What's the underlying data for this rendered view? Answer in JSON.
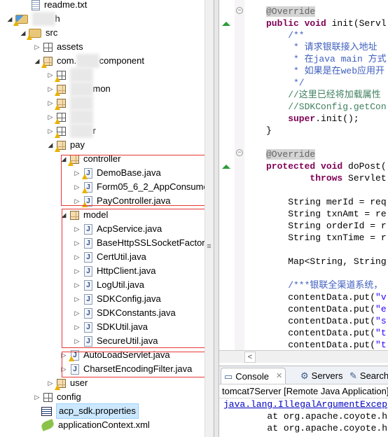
{
  "explorer": {
    "items": [
      {
        "label": "readme.txt",
        "icon": "text-file-icon"
      },
      {
        "label": "",
        "label_tail": "h",
        "icon": "web-project-icon",
        "blurred": true
      },
      {
        "label": "src",
        "icon": "source-folder-icon"
      },
      {
        "label": "assets",
        "icon": "package-icon"
      },
      {
        "label": "com.",
        "label_tail": "component",
        "icon": "package-icon",
        "blurred": true
      },
      {
        "label": "",
        "icon": "package-icon",
        "blurred": true
      },
      {
        "label": "",
        "label_tail": "mon",
        "icon": "package-icon",
        "blurred": true
      },
      {
        "label": "",
        "icon": "package-icon",
        "blurred": true
      },
      {
        "label": "",
        "icon": "package-icon",
        "blurred": true
      },
      {
        "label": "",
        "label_tail": "r",
        "icon": "package-icon",
        "blurred": true
      },
      {
        "label": "pay",
        "icon": "package-icon"
      },
      {
        "label": "controller",
        "icon": "package-icon"
      },
      {
        "label": "DemoBase.java",
        "icon": "java-file-icon"
      },
      {
        "label": "Form05_6_2_AppConsume.",
        "icon": "java-file-icon"
      },
      {
        "label": "PayController.java",
        "icon": "java-file-icon"
      },
      {
        "label": "model",
        "icon": "package-icon"
      },
      {
        "label": "AcpService.java",
        "icon": "java-file-icon"
      },
      {
        "label": "BaseHttpSSLSocketFactory",
        "icon": "java-file-icon"
      },
      {
        "label": "CertUtil.java",
        "icon": "java-file-icon"
      },
      {
        "label": "HttpClient.java",
        "icon": "java-file-icon"
      },
      {
        "label": "LogUtil.java",
        "icon": "java-file-icon"
      },
      {
        "label": "SDKConfig.java",
        "icon": "java-file-icon"
      },
      {
        "label": "SDKConstants.java",
        "icon": "java-file-icon"
      },
      {
        "label": "SDKUtil.java",
        "icon": "java-file-icon"
      },
      {
        "label": "SecureUtil.java",
        "icon": "java-file-icon"
      },
      {
        "label": "AutoLoadServlet.java",
        "icon": "java-file-icon"
      },
      {
        "label": "CharsetEncodingFilter.java",
        "icon": "java-file-icon"
      },
      {
        "label": "user",
        "icon": "package-icon"
      },
      {
        "label": "config",
        "icon": "package-icon"
      },
      {
        "label": "acp_sdk.properties",
        "icon": "properties-file-icon",
        "selected": true
      },
      {
        "label": "applicationContext.xml",
        "icon": "spring-xml-icon"
      }
    ],
    "highlight_color": "#e53935"
  },
  "editor": {
    "lines": [
      [
        {
          "t": "@Override",
          "c": "ann"
        }
      ],
      [
        {
          "t": "public void ",
          "c": "kw"
        },
        {
          "t": "init(Servl"
        }
      ],
      [
        {
          "t": "    /**",
          "c": "jd"
        }
      ],
      [
        {
          "t": "     * 请求银联接入地址",
          "c": "jd"
        }
      ],
      [
        {
          "t": "     * 在java main 方式",
          "c": "jd"
        }
      ],
      [
        {
          "t": "     * 如果是在web应用开",
          "c": "jd"
        }
      ],
      [
        {
          "t": "     */",
          "c": "jd"
        }
      ],
      [
        {
          "t": "    //这里已经将加载属性",
          "c": "cm"
        }
      ],
      [
        {
          "t": "    //SDKConfig.getCon",
          "c": "cm"
        }
      ],
      [
        {
          "t": "    super",
          "c": "kw"
        },
        {
          "t": ".init();"
        }
      ],
      [
        {
          "t": "}"
        }
      ],
      [],
      [
        {
          "t": "@Override",
          "c": "ann"
        }
      ],
      [
        {
          "t": "protected void ",
          "c": "kw"
        },
        {
          "t": "doPost("
        }
      ],
      [
        {
          "t": "        throws ",
          "c": "kw"
        },
        {
          "t": "Servlet"
        }
      ],
      [],
      [
        {
          "t": "    String merId = req"
        }
      ],
      [
        {
          "t": "    String txnAmt = re"
        }
      ],
      [
        {
          "t": "    String orderId = r"
        }
      ],
      [
        {
          "t": "    String txnTime = r"
        }
      ],
      [],
      [
        {
          "t": "    Map<String, String"
        }
      ],
      [],
      [
        {
          "t": "    /***银联全渠道系统，",
          "c": "jd"
        }
      ],
      [
        {
          "t": "    contentData.put("
        },
        {
          "t": "\"v",
          "c": "st"
        }
      ],
      [
        {
          "t": "    contentData.put("
        },
        {
          "t": "\"e",
          "c": "st"
        }
      ],
      [
        {
          "t": "    contentData.put("
        },
        {
          "t": "\"s",
          "c": "st"
        }
      ],
      [
        {
          "t": "    contentData.put("
        },
        {
          "t": "\"t",
          "c": "st"
        }
      ],
      [
        {
          "t": "    contentData.put("
        },
        {
          "t": "\"t",
          "c": "st"
        }
      ]
    ]
  },
  "console": {
    "tabs": [
      {
        "label": "Console",
        "icon": "console-icon",
        "active": true
      },
      {
        "label": "Servers",
        "icon": "servers-icon"
      },
      {
        "label": "Search",
        "icon": "search-icon"
      }
    ],
    "close_glyph": "✕",
    "status": "tomcat7Server [Remote Java Application]",
    "lines": [
      {
        "t": "java.lang.IllegalArgumentExcep",
        "link": true
      },
      {
        "t": "        at org.apache.coyote.h"
      },
      {
        "t": "        at org.apache.coyote.h"
      }
    ]
  },
  "scroll_left_glyph": "<"
}
